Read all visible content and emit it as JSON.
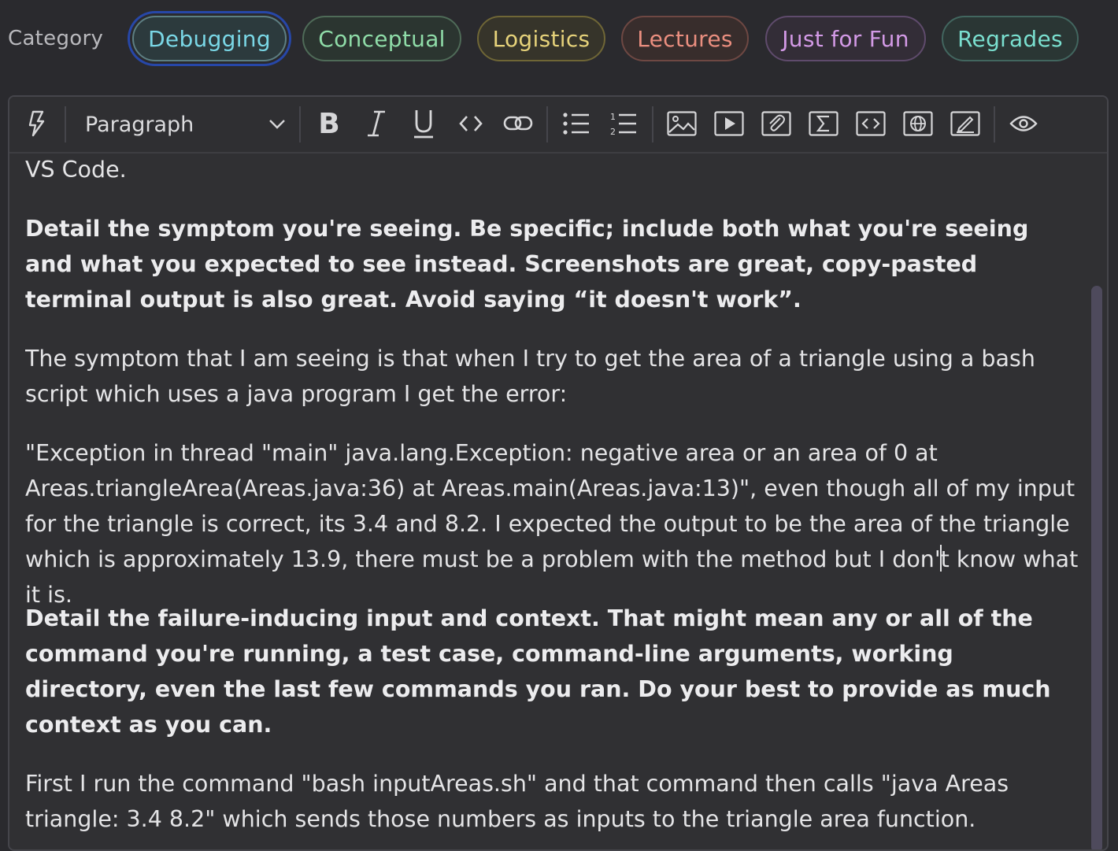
{
  "category": {
    "label": "Category",
    "chips": [
      {
        "label": "Debugging",
        "text": "#7ad7e6",
        "border": "#5d7f83",
        "bg": "#2c3a3d",
        "selected": true
      },
      {
        "label": "Conceptual",
        "text": "#8fdca8",
        "border": "#4f6b58",
        "bg": "#2b3530"
      },
      {
        "label": "Logistics",
        "text": "#e6d27a",
        "border": "#6f6636",
        "bg": "#36342a"
      },
      {
        "label": "Lectures",
        "text": "#ea8e7f",
        "border": "#6e4843",
        "bg": "#382d2c"
      },
      {
        "label": "Just for Fun",
        "text": "#d39ae6",
        "border": "#5f4b6c",
        "bg": "#332d37"
      },
      {
        "label": "Regrades",
        "text": "#7adfcf",
        "border": "#42665f",
        "bg": "#2a3634"
      }
    ]
  },
  "toolbar": {
    "block_type": "Paragraph",
    "icons": [
      "lightning-icon",
      "bold-icon",
      "italic-icon",
      "underline-icon",
      "inline-code-icon",
      "link-icon",
      "bullet-list-icon",
      "numbered-list-icon",
      "image-icon",
      "video-icon",
      "attachment-icon",
      "math-icon",
      "code-block-icon",
      "embed-web-icon",
      "drawing-icon",
      "preview-icon"
    ]
  },
  "content": {
    "p0": "VS Code.",
    "p1": "Detail the symptom you're seeing. Be specific; include both what you're seeing and what you expected to see instead. Screenshots are great, copy-pasted terminal output is also great. Avoid saying “it doesn't work”.",
    "p2": "The symptom that I am seeing is that when I try to get the area of a triangle using a bash script which uses a java program I get the error:",
    "p3_before_caret": "\"Exception in thread \"main\" java.lang.Exception: negative area or an area of 0 at Areas.triangleArea(Areas.java:36) at Areas.main(Areas.java:13)\", even though all of my input for the triangle is correct, its 3.4 and 8.2. I expected the output to be the area of the triangle which is approximately 13.9, there must be a problem with the method but I don'",
    "p3_after_caret": "t know what it is.",
    "p4": "Detail the failure-inducing input and context. That might mean any or all of the command you're running, a test case, command-line arguments, working directory, even the last few commands you ran. Do your best to provide as much context as you can.",
    "p5": "First I run the command \"bash inputAreas.sh\" and that command then calls \"java Areas triangle: 3.4 8.2\" which sends those numbers as inputs to the triangle area function."
  }
}
